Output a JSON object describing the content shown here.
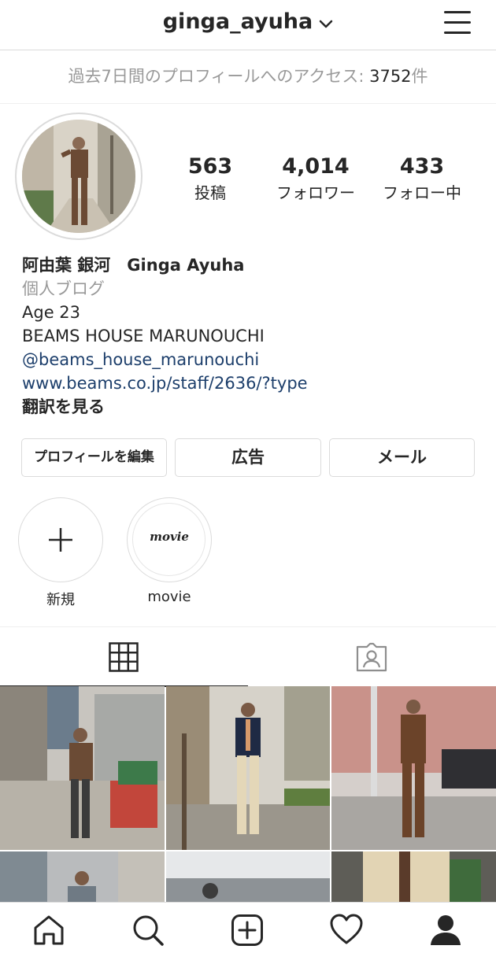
{
  "header": {
    "username": "ginga_ayuha",
    "menu_icon": "hamburger-menu-icon"
  },
  "access_banner": {
    "prefix": "過去7日間のプロフィールへのアクセス: ",
    "count": "3752",
    "suffix": "件"
  },
  "profile": {
    "stats": [
      {
        "value": "563",
        "label": "投稿"
      },
      {
        "value": "4,014",
        "label": "フォロワー"
      },
      {
        "value": "433",
        "label": "フォロー中"
      }
    ],
    "name": "阿由葉 銀河　Ginga Ayuha",
    "category": "個人ブログ",
    "bio_lines": [
      "Age 23",
      "BEAMS HOUSE MARUNOUCHI"
    ],
    "mention": "@beams_house_marunouchi",
    "website": "www.beams.co.jp/staff/2636/?type",
    "translate": "翻訳を見る"
  },
  "buttons": {
    "edit_profile": "プロフィールを編集",
    "promotions": "広告",
    "email": "メール"
  },
  "highlights": [
    {
      "label": "新規",
      "icon": "plus-icon"
    },
    {
      "label": "movie",
      "cover_text": "movie"
    }
  ],
  "tabs": [
    {
      "name": "grid",
      "icon": "grid-icon",
      "active": true
    },
    {
      "name": "tagged",
      "icon": "tagged-person-icon",
      "active": false
    }
  ],
  "bottom_nav": [
    {
      "name": "home",
      "icon": "home-icon"
    },
    {
      "name": "search",
      "icon": "search-icon"
    },
    {
      "name": "new-post",
      "icon": "add-post-icon"
    },
    {
      "name": "activity",
      "icon": "heart-icon"
    },
    {
      "name": "profile",
      "icon": "profile-icon",
      "active": true
    }
  ],
  "colors": {
    "text": "#262626",
    "muted": "#999999",
    "link": "#1c3e6b",
    "border": "#dbdbdb"
  }
}
